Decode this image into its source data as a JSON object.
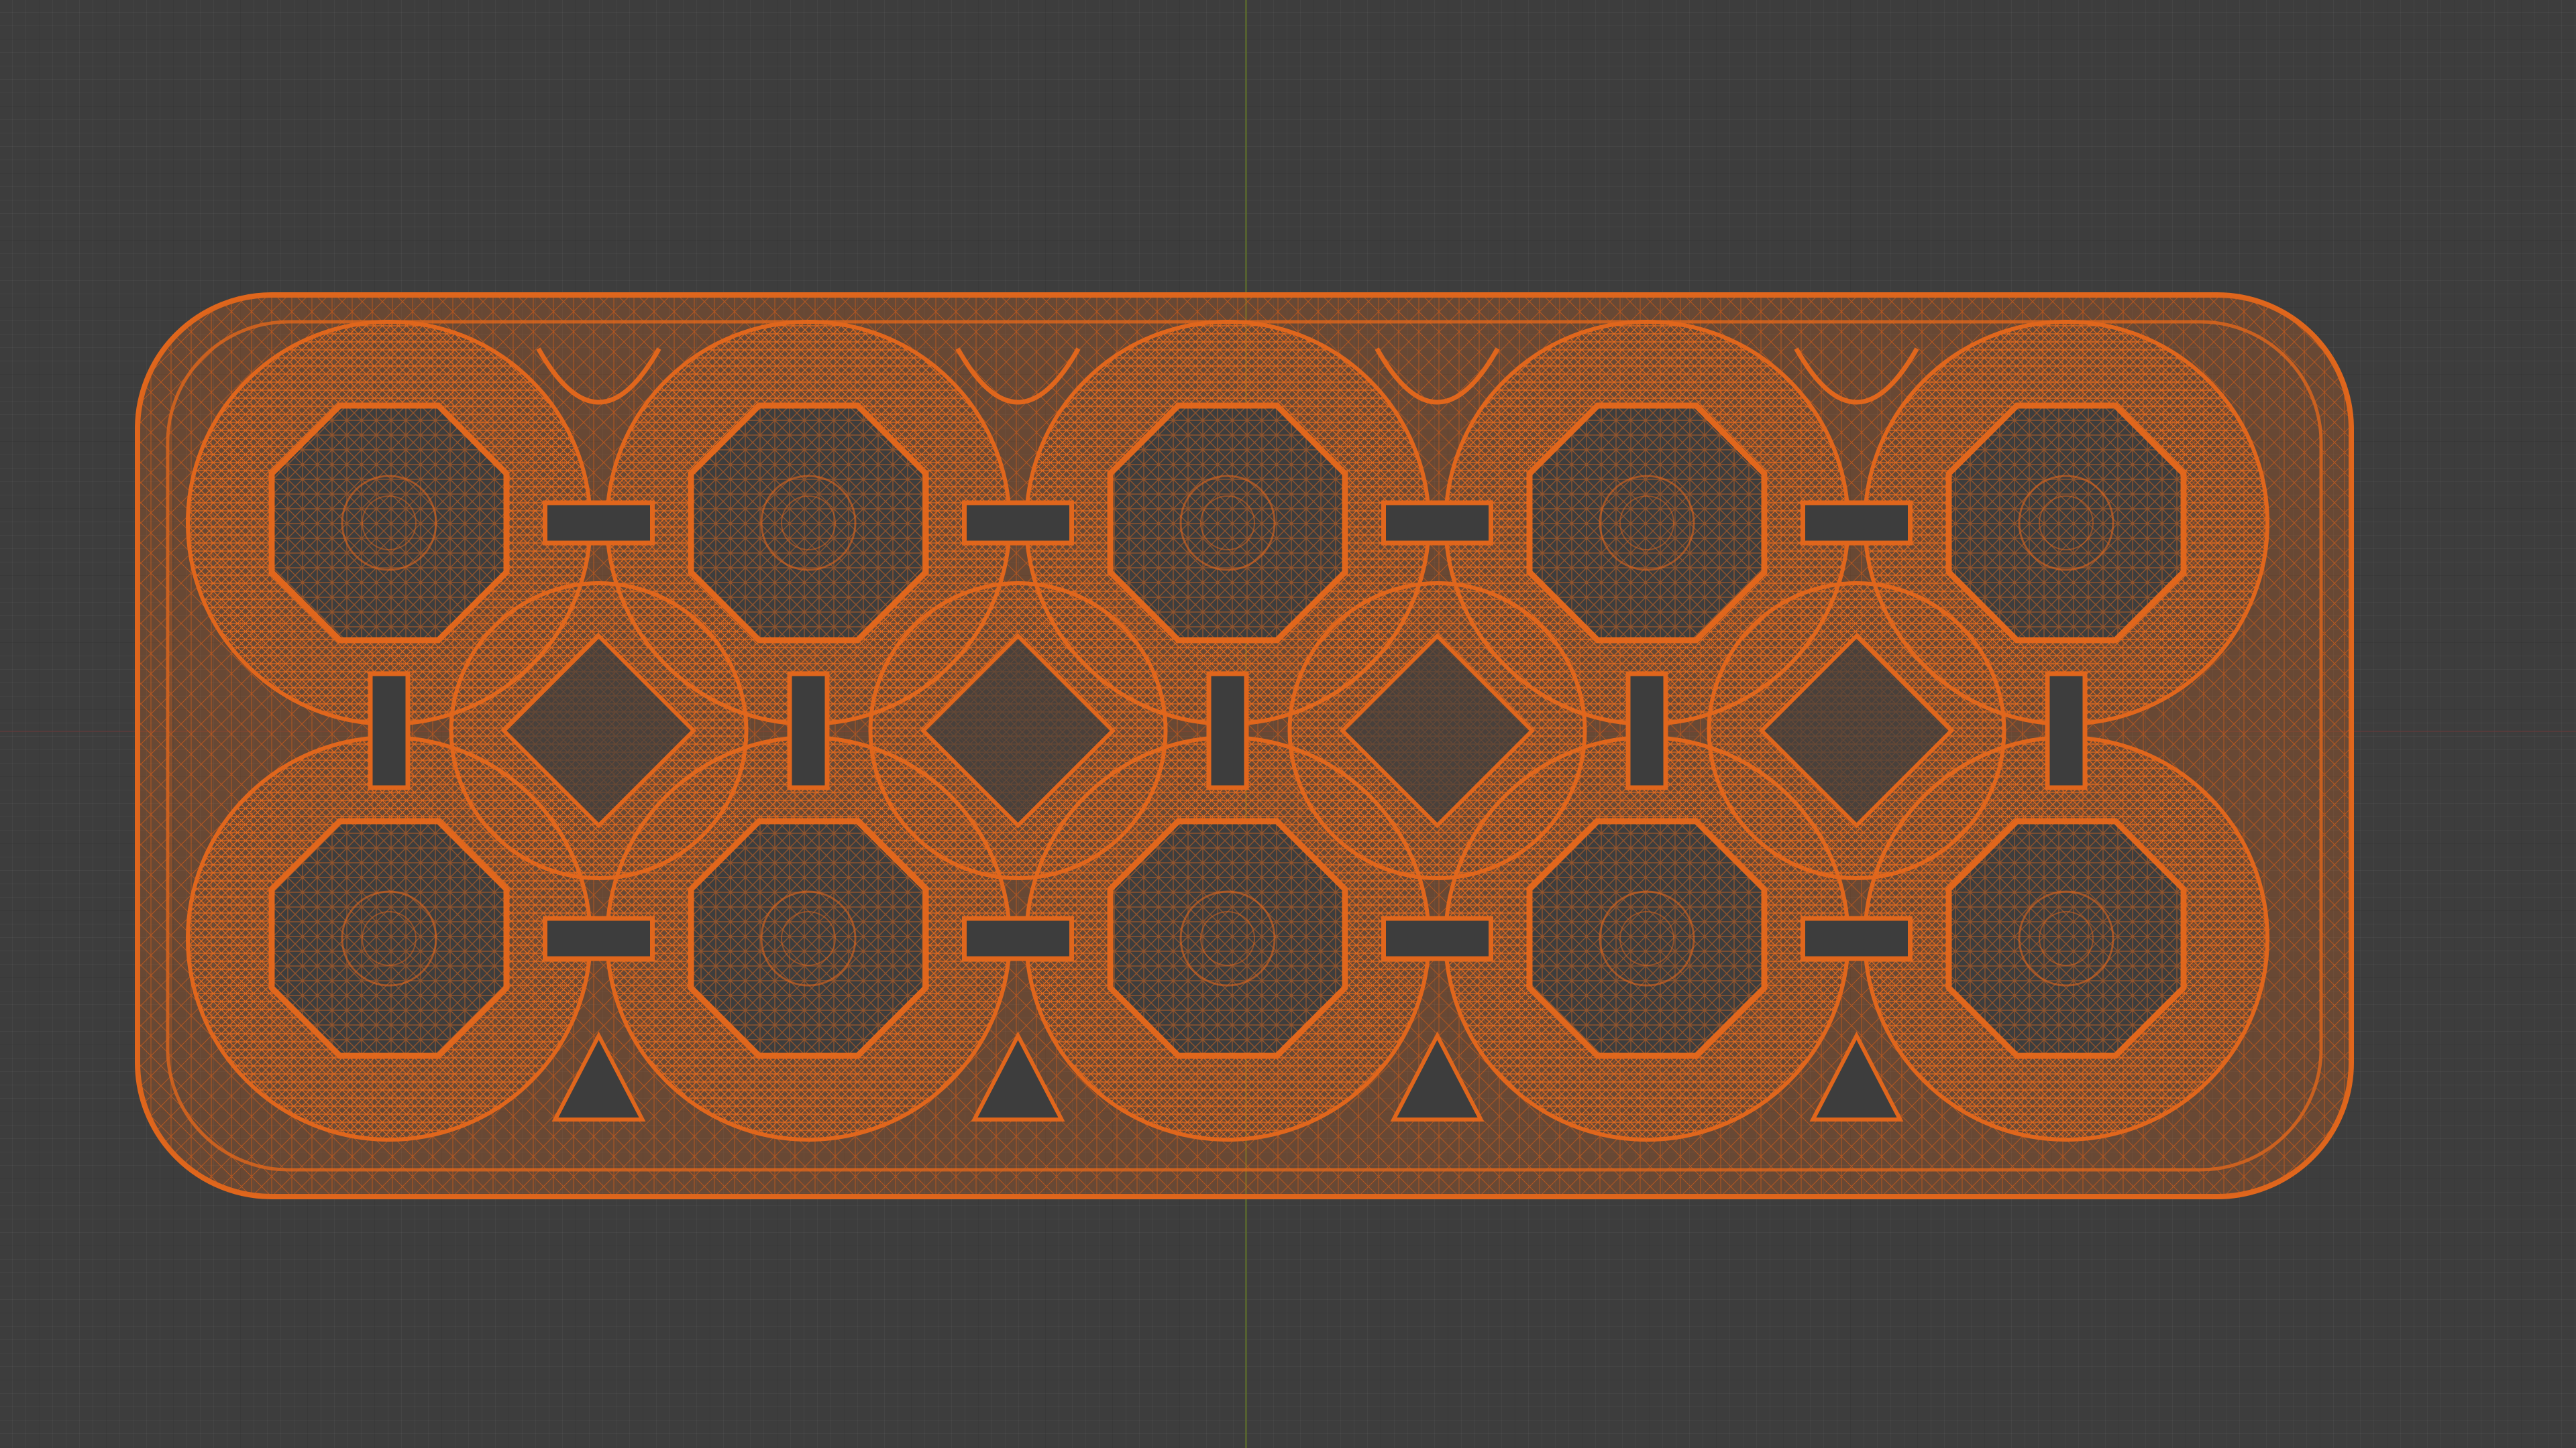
{
  "viewport": {
    "mode": "wireframe",
    "background_color": "#3d3d3d",
    "grid_visible": true,
    "axis_x_color": "#6a3a3a",
    "axis_y_color": "#5e6e2e"
  },
  "object": {
    "name_hint": "egg-carton-mesh",
    "display": "wireframe",
    "selected": true,
    "wire_color": "#e0661c",
    "cups": {
      "rows": 2,
      "columns": 5
    },
    "icon": "mesh-object-icon"
  }
}
